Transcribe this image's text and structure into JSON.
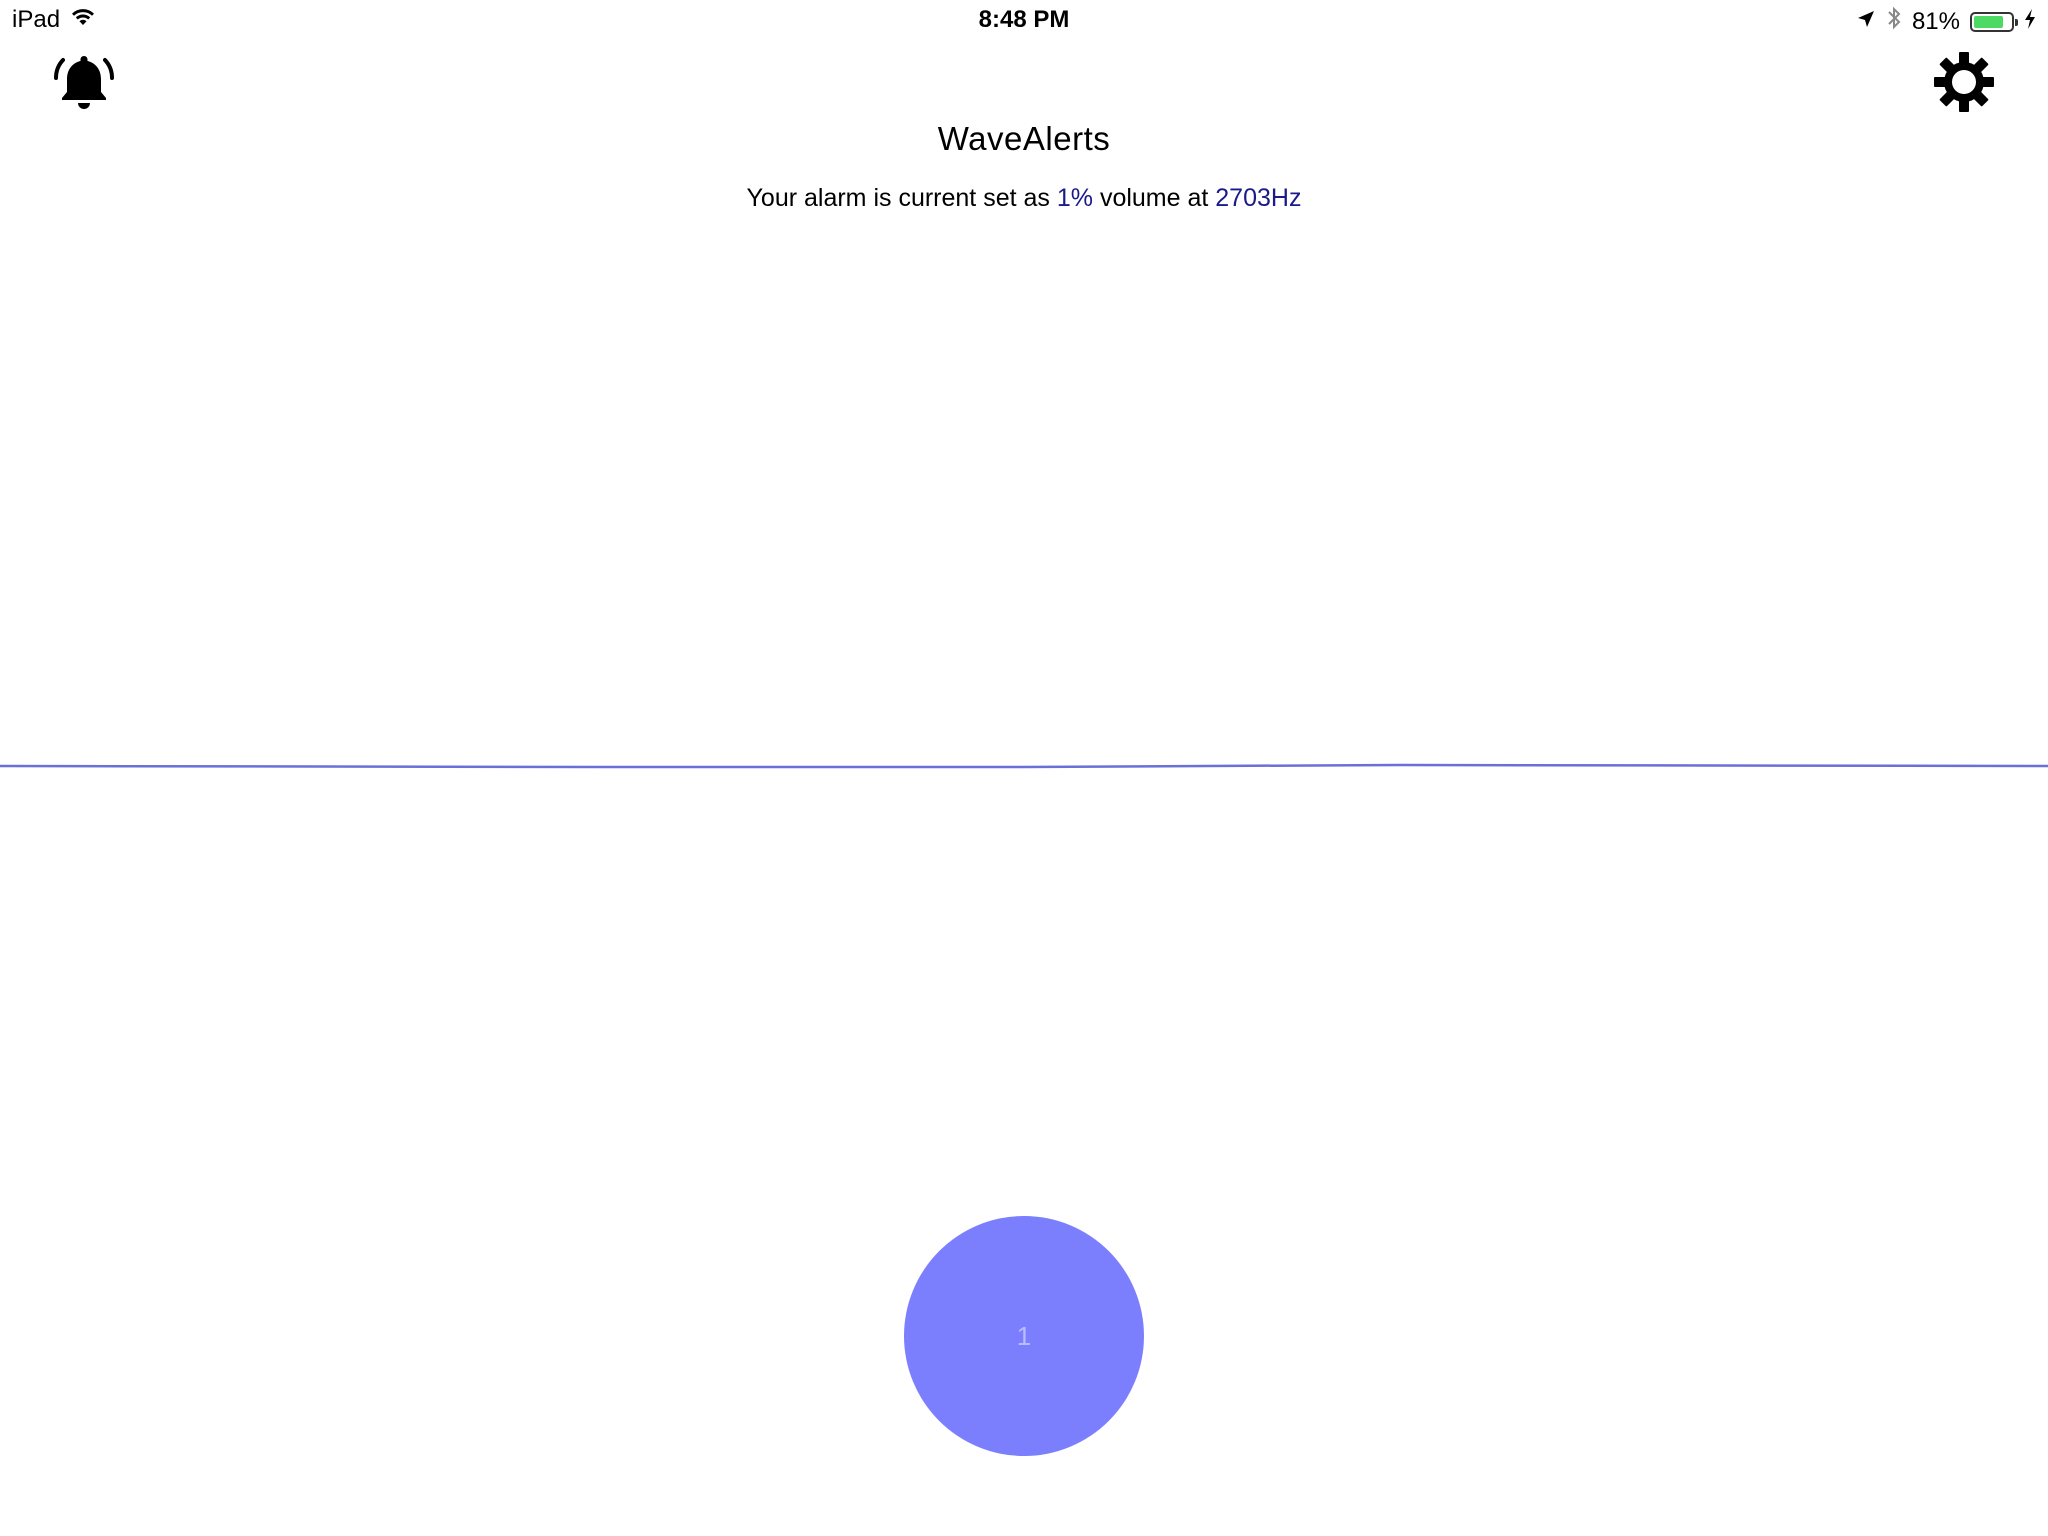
{
  "status_bar": {
    "device": "iPad",
    "time": "8:48 PM",
    "battery_percent": "81%",
    "battery_level": 0.81,
    "icons": [
      "wifi-icon",
      "location-arrow-icon",
      "bluetooth-icon",
      "battery-icon",
      "charging-bolt-icon"
    ]
  },
  "nav": {
    "left_icon": "bell-icon",
    "right_icon": "gear-icon"
  },
  "header": {
    "title": "WaveAlerts",
    "subtitle_prefix": "Your alarm is current set as ",
    "volume": "1%",
    "subtitle_middle": " volume at ",
    "frequency": "2703Hz"
  },
  "main": {
    "wave_color": "#6b6fd8",
    "circle_color": "#7b7ffd",
    "circle_label": "1"
  },
  "colors": {
    "accent_text": "#1a1a8c",
    "battery_green": "#4cd964"
  }
}
